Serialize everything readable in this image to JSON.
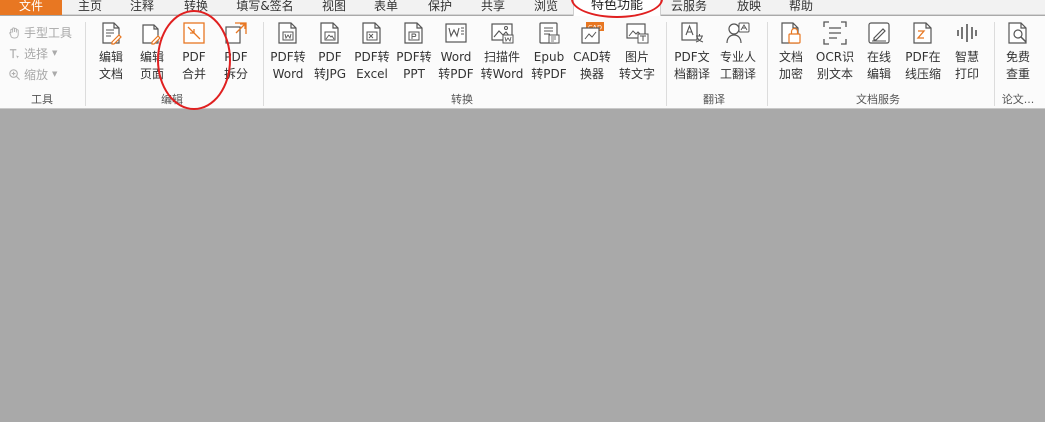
{
  "menu_tabs": [
    {
      "label": "文件"
    },
    {
      "label": "主页"
    },
    {
      "label": "注释"
    },
    {
      "label": "转换"
    },
    {
      "label": "填写&签名"
    },
    {
      "label": "视图"
    },
    {
      "label": "表单"
    },
    {
      "label": "保护"
    },
    {
      "label": "共享"
    },
    {
      "label": "浏览"
    },
    {
      "label": "特色功能"
    },
    {
      "label": "云服务"
    },
    {
      "label": "放映"
    },
    {
      "label": "帮助"
    }
  ],
  "active_tab": "特色功能",
  "tools": {
    "hand": "手型工具",
    "select": "选择",
    "zoom": "缩放",
    "group": "工具"
  },
  "edit_group": {
    "label": "编辑",
    "buttons": [
      {
        "line1": "编辑",
        "line2": "文档",
        "icon": "edit-document-icon"
      },
      {
        "line1": "编辑",
        "line2": "页面",
        "icon": "edit-page-icon"
      },
      {
        "line1": "PDF",
        "line2": "合并",
        "icon": "pdf-merge-icon"
      },
      {
        "line1": "PDF",
        "line2": "拆分",
        "icon": "pdf-split-icon"
      }
    ]
  },
  "convert_group": {
    "label": "转换",
    "buttons": [
      {
        "line1": "PDF转",
        "line2": "Word",
        "icon": "pdf-to-word-icon"
      },
      {
        "line1": "PDF",
        "line2": "转JPG",
        "icon": "pdf-to-jpg-icon"
      },
      {
        "line1": "PDF转",
        "line2": "Excel",
        "icon": "pdf-to-excel-icon"
      },
      {
        "line1": "PDF转",
        "line2": "PPT",
        "icon": "pdf-to-ppt-icon"
      },
      {
        "line1": "Word",
        "line2": "转PDF",
        "icon": "word-to-pdf-icon"
      },
      {
        "line1": "扫描件",
        "line2": "转Word",
        "icon": "scan-to-word-icon"
      },
      {
        "line1": "Epub",
        "line2": "转PDF",
        "icon": "epub-to-pdf-icon"
      },
      {
        "line1": "CAD转",
        "line2": "换器",
        "icon": "cad-converter-icon",
        "badge": "CAD"
      },
      {
        "line1": "图片",
        "line2": "转文字",
        "icon": "image-to-text-icon"
      }
    ]
  },
  "translate_group": {
    "label": "翻译",
    "buttons": [
      {
        "line1": "PDF文",
        "line2": "档翻译",
        "icon": "pdf-translate-icon"
      },
      {
        "line1": "专业人",
        "line2": "工翻译",
        "icon": "human-translate-icon"
      }
    ]
  },
  "docservice_group": {
    "label": "文档服务",
    "buttons": [
      {
        "line1": "文档",
        "line2": "加密",
        "icon": "document-encrypt-icon"
      },
      {
        "line1": "OCR识",
        "line2": "别文本",
        "icon": "ocr-icon"
      },
      {
        "line1": "在线",
        "line2": "编辑",
        "icon": "online-edit-icon"
      },
      {
        "line1": "PDF在",
        "line2": "线压缩",
        "icon": "online-compress-icon"
      },
      {
        "line1": "智慧",
        "line2": "打印",
        "icon": "smart-print-icon"
      }
    ]
  },
  "paper_group": {
    "label": "论文...",
    "buttons": [
      {
        "line1": "免费",
        "line2": "查重",
        "icon": "plagiarism-check-icon"
      }
    ]
  },
  "colors": {
    "accent": "#e87722",
    "annotation_ring": "#e02020",
    "workspace": "#a9a9a9",
    "icon_stroke": "#555555"
  }
}
